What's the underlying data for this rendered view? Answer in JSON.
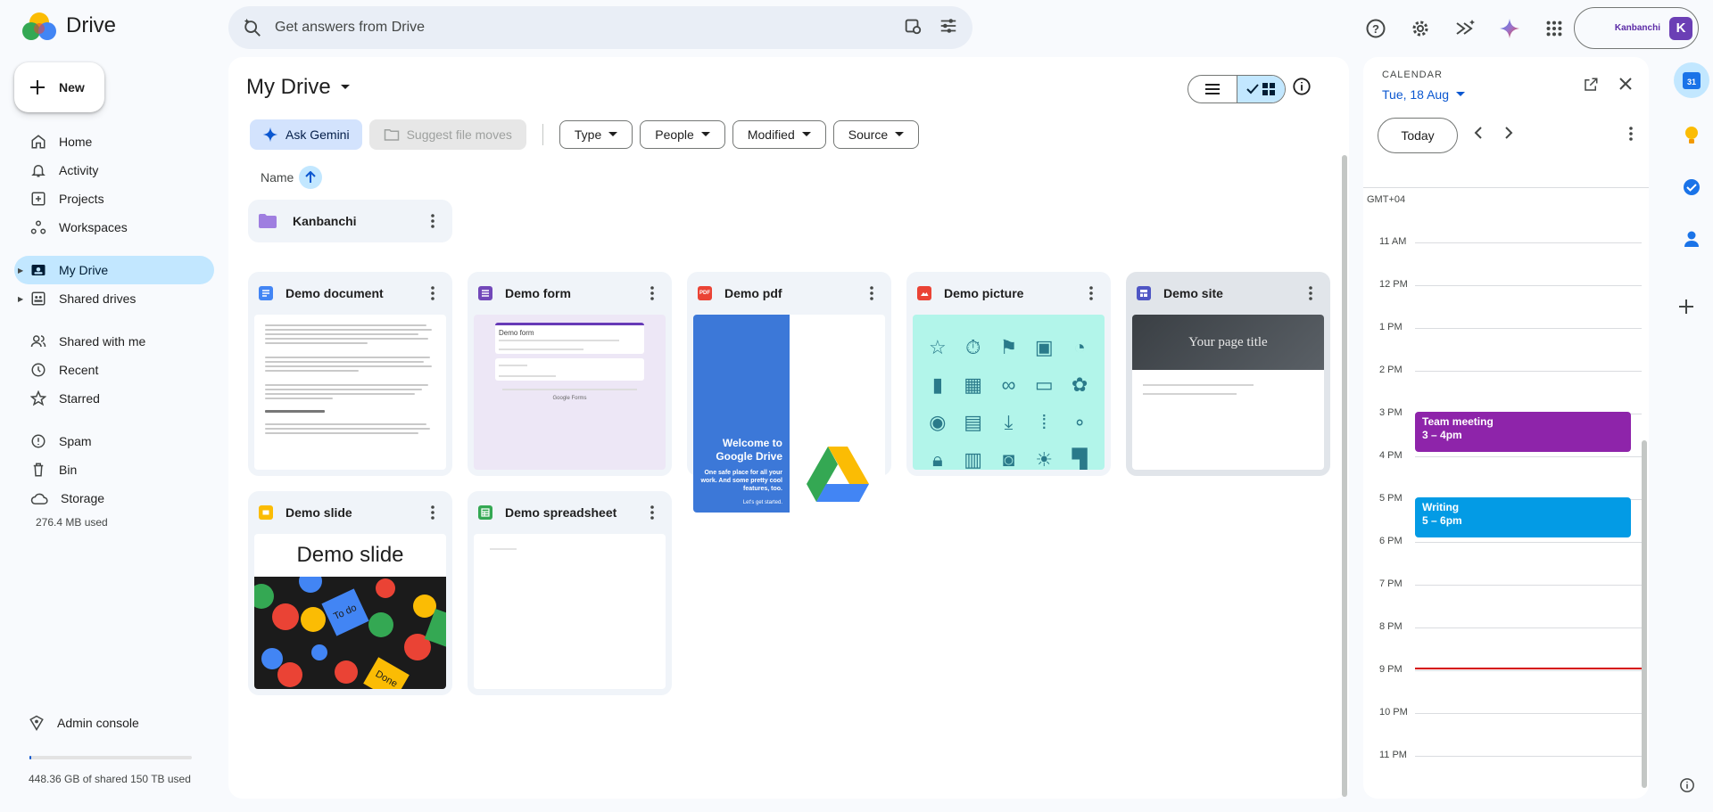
{
  "app": {
    "name": "Drive"
  },
  "search": {
    "placeholder": "Get answers from Drive"
  },
  "account": {
    "name": "Kanbanchi",
    "initial": "K"
  },
  "sidebar": {
    "new_label": "New",
    "items": [
      {
        "label": "Home",
        "icon": "home-icon"
      },
      {
        "label": "Activity",
        "icon": "bell-icon"
      },
      {
        "label": "Projects",
        "icon": "projects-icon"
      },
      {
        "label": "Workspaces",
        "icon": "workspaces-icon"
      },
      {
        "label": "My Drive",
        "icon": "my-drive-icon",
        "active": true
      },
      {
        "label": "Shared drives",
        "icon": "shared-drives-icon"
      },
      {
        "label": "Shared with me",
        "icon": "people-icon"
      },
      {
        "label": "Recent",
        "icon": "clock-icon"
      },
      {
        "label": "Starred",
        "icon": "star-icon"
      },
      {
        "label": "Spam",
        "icon": "spam-icon"
      },
      {
        "label": "Bin",
        "icon": "trash-icon"
      },
      {
        "label": "Storage",
        "icon": "cloud-icon"
      }
    ],
    "storage_used": "276.4 MB used",
    "admin_label": "Admin console",
    "quota_text": "448.36 GB of shared 150 TB used",
    "quota_fraction": 0.003
  },
  "main": {
    "title": "My Drive",
    "ask_gemini": "Ask Gemini",
    "suggest_moves": "Suggest file moves",
    "filters": [
      "Type",
      "People",
      "Modified",
      "Source"
    ],
    "sort_label": "Name",
    "folder": {
      "name": "Kanbanchi"
    },
    "files": [
      {
        "name": "Demo document",
        "type": "doc"
      },
      {
        "name": "Demo form",
        "type": "form"
      },
      {
        "name": "Demo pdf",
        "type": "pdf"
      },
      {
        "name": "Demo picture",
        "type": "image"
      },
      {
        "name": "Demo site",
        "type": "site"
      },
      {
        "name": "Demo slide",
        "type": "slide"
      },
      {
        "name": "Demo spreadsheet",
        "type": "sheet"
      }
    ],
    "thumbs": {
      "form_title": "Demo form",
      "form_footer": "Google Forms",
      "pdf_big": "Welcome to Google Drive",
      "pdf_small": "One safe place for all your work. And some pretty cool features, too.",
      "pdf_tiny": "Let's get started.",
      "site_title": "Your page title",
      "slide_title": "Demo slide",
      "sticky_1": "To do",
      "sticky_2": "Done"
    }
  },
  "calendar": {
    "label": "CALENDAR",
    "date": "Tue, 18 Aug",
    "today": "Today",
    "timezone": "GMT+04",
    "hours": [
      "11 AM",
      "12 PM",
      "1 PM",
      "2 PM",
      "3 PM",
      "4 PM",
      "5 PM",
      "6 PM",
      "7 PM",
      "8 PM",
      "9 PM",
      "10 PM",
      "11 PM"
    ],
    "events": [
      {
        "title": "Team meeting",
        "time": "3 – 4pm",
        "color": "#8e24aa"
      },
      {
        "title": "Writing",
        "time": "5 – 6pm",
        "color": "#039be5"
      }
    ]
  },
  "colors": {
    "accent": "#0b57d0",
    "active_bg": "#c2e7ff",
    "now_line": "#d50000"
  }
}
